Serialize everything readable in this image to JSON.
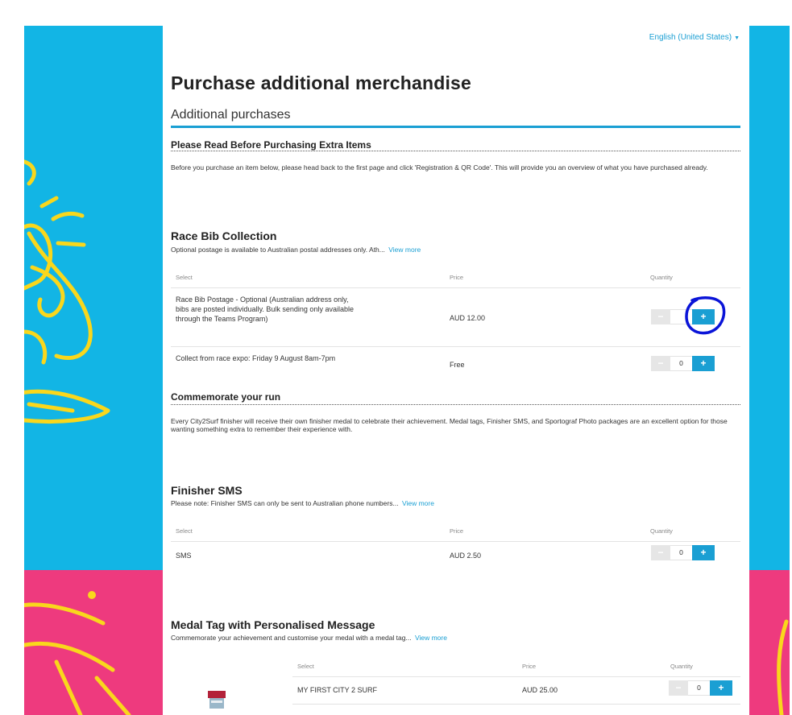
{
  "header": {
    "language": "English (United States)",
    "page_title": "Purchase additional merchandise",
    "tab_title": "Additional purchases"
  },
  "read_before": {
    "heading": "Please Read Before Purchasing Extra Items",
    "text": "Before you purchase an item below, please head back to the first page and click 'Registration & QR Code'. This will provide you an overview of what you have purchased already."
  },
  "products": {
    "race_bib": {
      "title": "Race Bib Collection",
      "description": "Optional postage is available to Australian postal addresses only. Ath...",
      "view_more": "View more",
      "columns": {
        "select": "Select",
        "price": "Price",
        "quantity": "Quantity"
      },
      "rows": [
        {
          "name": "Race Bib Postage - Optional (Australian address only, bibs are posted individually. Bulk sending only available through the Teams Program)",
          "price": "AUD 12.00",
          "minus": "−",
          "plus": "+"
        },
        {
          "name": "Collect from race expo: Friday 9 August 8am-7pm",
          "price": "Free",
          "qty": "0",
          "minus": "−",
          "plus": "+"
        }
      ]
    },
    "commemorate": {
      "heading": "Commemorate your run",
      "text": "Every City2Surf finisher will receive their own finisher medal to celebrate their achievement. Medal tags, Finisher SMS, and Sportograf Photo packages are an excellent option for those wanting something extra to remember their experience with."
    },
    "finisher_sms": {
      "title": "Finisher SMS",
      "description": "Please note: Finisher SMS can only be sent to Australian phone numbers...",
      "view_more": "View more",
      "columns": {
        "select": "Select",
        "price": "Price",
        "quantity": "Quantity"
      },
      "rows": [
        {
          "name": "SMS",
          "price": "AUD 2.50",
          "qty": "0",
          "minus": "−",
          "plus": "+"
        }
      ]
    },
    "medal_tag": {
      "title": "Medal Tag with Personalised Message",
      "description": "Commemorate your achievement and customise your medal with a medal tag...",
      "view_more": "View more",
      "columns": {
        "select": "Select",
        "price": "Price",
        "quantity": "Quantity"
      },
      "rows": [
        {
          "name": "MY FIRST CITY 2 SURF",
          "price": "AUD 25.00",
          "qty": "0",
          "minus": "−",
          "plus": "+"
        }
      ]
    }
  },
  "colors": {
    "accent": "#1a9fd3",
    "background_blue": "#12b5e5",
    "background_pink": "#ee3a7e",
    "artwork_yellow": "#f9d71c",
    "annotation_blue": "#0a14d8"
  }
}
